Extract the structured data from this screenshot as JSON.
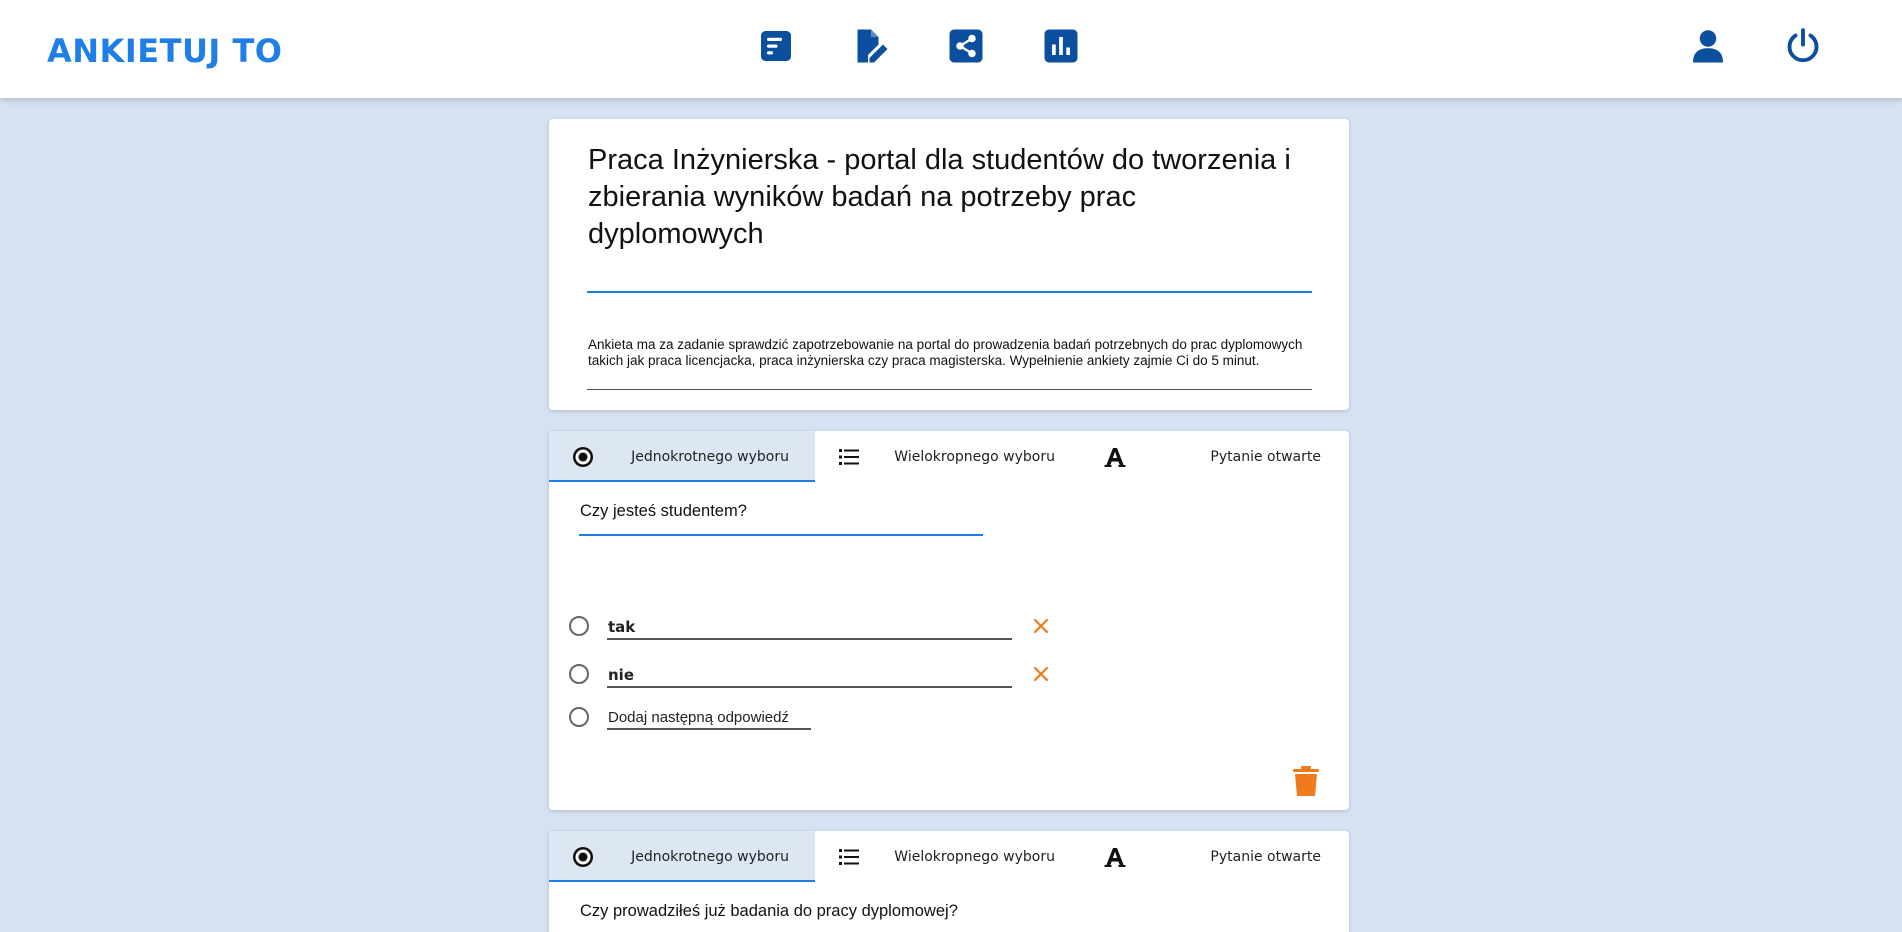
{
  "header": {
    "brand": "ANKIETUJ TO",
    "nav_icons": [
      "form-editor-icon",
      "file-edit-icon",
      "share-icon",
      "chart-icon"
    ],
    "right_icons": [
      "user-icon",
      "power-icon"
    ],
    "accent_color": "#1f7fe5",
    "icon_color": "#0b4f9e"
  },
  "survey": {
    "title": "Praca Inżynierska - portal dla studentów do tworzenia i zbierania wyników badań na potrzeby prac dyplomowych",
    "description": "Ankieta ma za zadanie sprawdzić zapotrzebowanie na portal do prowadzenia badań potrzebnych do prac dyplomowych takich jak praca licencjacka, praca inżynierska czy praca magisterska. Wypełnienie ankiety zajmie Ci do 5 minut."
  },
  "question_types": {
    "single": "Jednokrotnego wyboru",
    "multiple": "Wielokropnego wyboru",
    "open": "Pytanie otwarte"
  },
  "questions": [
    {
      "text": "Czy jesteś studentem?",
      "active_type": "single",
      "answers": [
        "tak",
        "nie"
      ],
      "add_answer_label": "Dodaj następną odpowiedź"
    },
    {
      "text": "Czy prowadziłeś już badania do pracy dyplomowej?",
      "active_type": "single"
    }
  ],
  "colors": {
    "background": "#d6e2f2",
    "remove": "#f07b1c",
    "trash": "#f07b1c"
  }
}
